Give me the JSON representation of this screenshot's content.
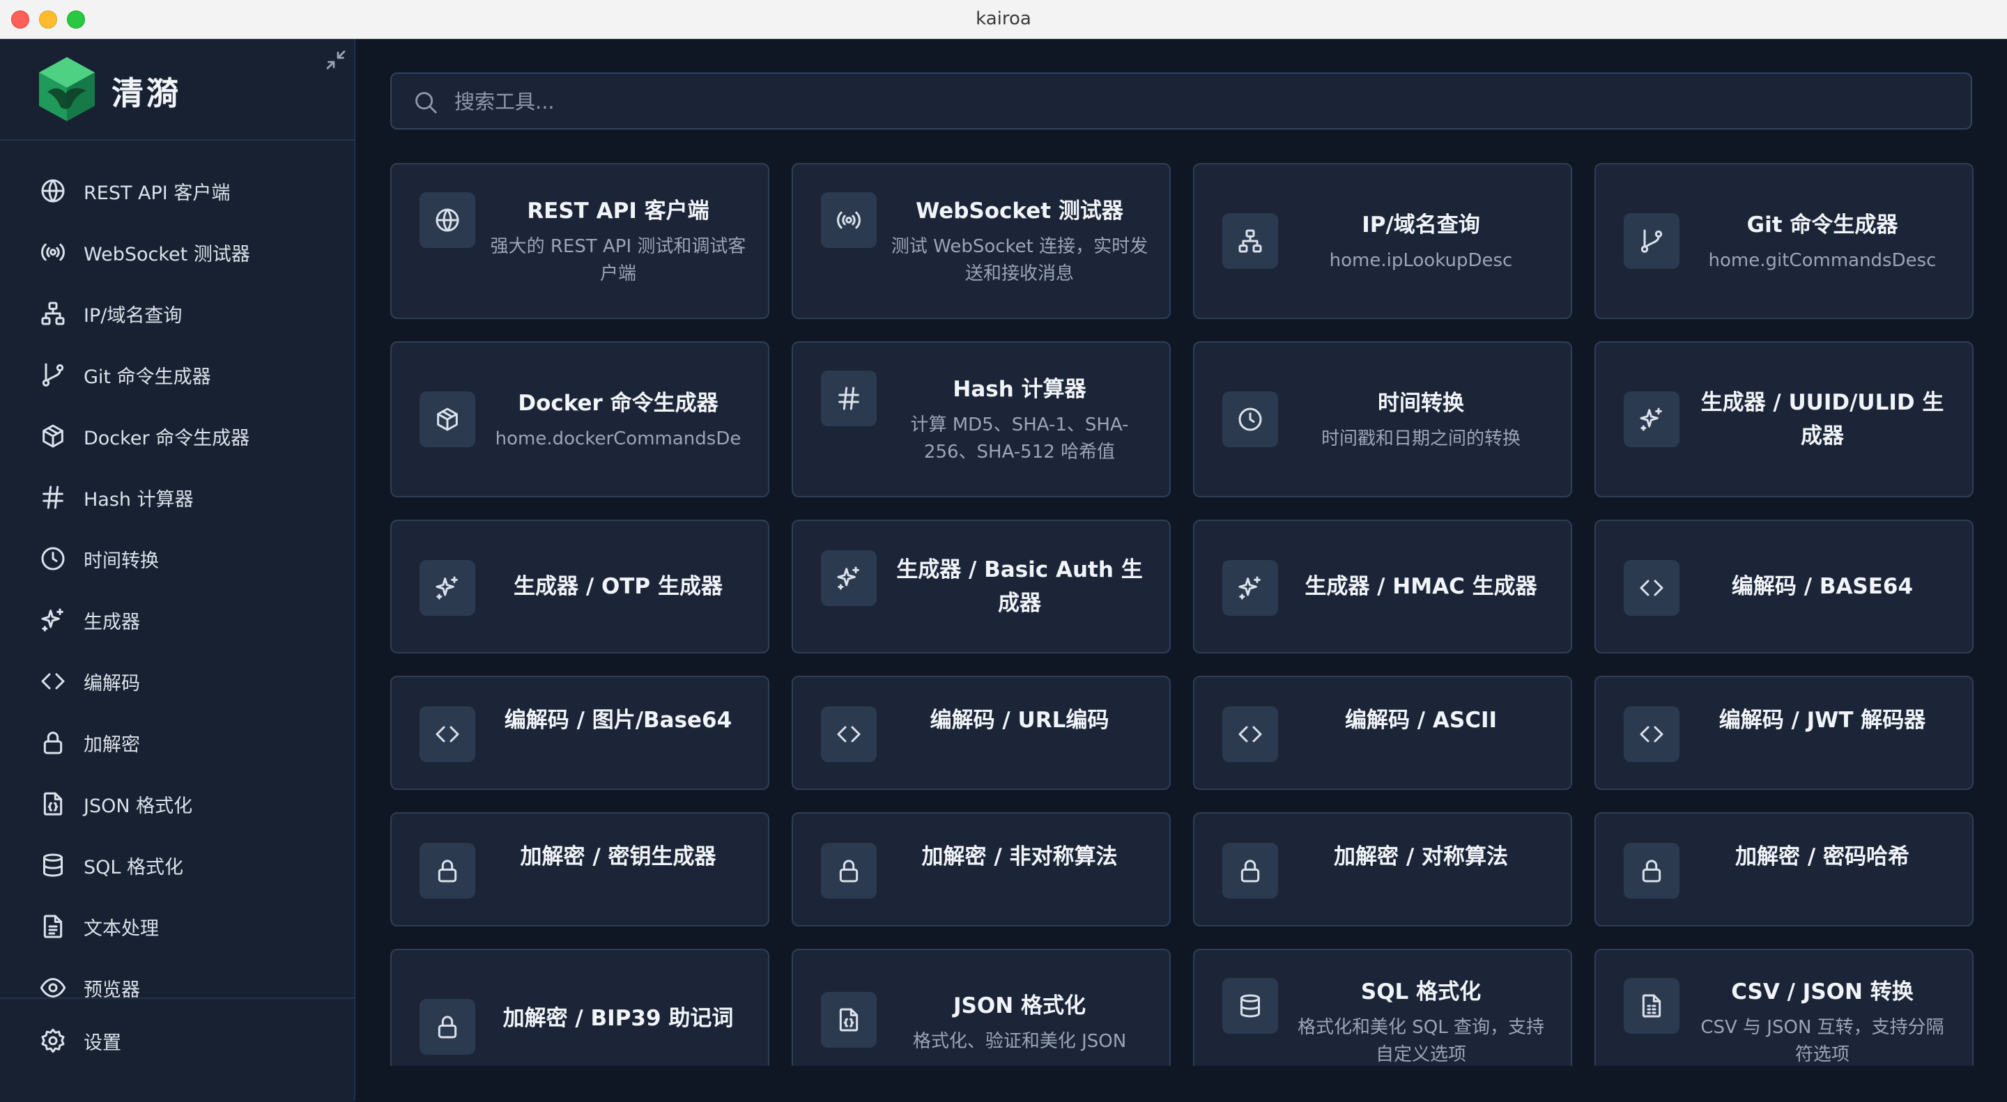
{
  "window": {
    "title": "kairoa"
  },
  "brand": {
    "name": "清漪"
  },
  "search": {
    "placeholder": "搜索工具..."
  },
  "sidebar": {
    "items": [
      {
        "label": "REST API 客户端",
        "icon": "globe-icon"
      },
      {
        "label": "WebSocket 测试器",
        "icon": "radio-icon"
      },
      {
        "label": "IP/域名查询",
        "icon": "network-icon"
      },
      {
        "label": "Git 命令生成器",
        "icon": "git-branch-icon"
      },
      {
        "label": "Docker 命令生成器",
        "icon": "package-icon"
      },
      {
        "label": "Hash 计算器",
        "icon": "hash-icon"
      },
      {
        "label": "时间转换",
        "icon": "clock-icon"
      },
      {
        "label": "生成器",
        "icon": "sparkles-icon"
      },
      {
        "label": "编解码",
        "icon": "code-icon"
      },
      {
        "label": "加解密",
        "icon": "lock-icon"
      },
      {
        "label": "JSON 格式化",
        "icon": "file-json-icon"
      },
      {
        "label": "SQL 格式化",
        "icon": "database-icon"
      },
      {
        "label": "文本处理",
        "icon": "file-text-icon"
      },
      {
        "label": "预览器",
        "icon": "eye-icon"
      }
    ],
    "settings": {
      "label": "设置",
      "icon": "gear-icon"
    }
  },
  "cards": [
    {
      "title": "REST API 客户端",
      "desc": "强大的 REST API 测试和调试客户端",
      "icon": "globe-icon"
    },
    {
      "title": "WebSocket 测试器",
      "desc": "测试 WebSocket 连接，实时发送和接收消息",
      "icon": "radio-icon"
    },
    {
      "title": "IP/域名查询",
      "desc": "home.ipLookupDesc",
      "icon": "network-icon"
    },
    {
      "title": "Git 命令生成器",
      "desc": "home.gitCommandsDesc",
      "icon": "git-branch-icon"
    },
    {
      "title": "Docker 命令生成器",
      "desc": "home.dockerCommandsDe",
      "icon": "package-icon"
    },
    {
      "title": "Hash 计算器",
      "desc": "计算 MD5、SHA-1、SHA-256、SHA-512 哈希值",
      "icon": "hash-icon"
    },
    {
      "title": "时间转换",
      "desc": "时间戳和日期之间的转换",
      "icon": "clock-icon"
    },
    {
      "title": "生成器 / UUID/ULID 生成器",
      "desc": "",
      "icon": "sparkles-icon"
    },
    {
      "title": "生成器 / OTP 生成器",
      "desc": "",
      "icon": "sparkles-icon"
    },
    {
      "title": "生成器 / Basic Auth 生成器",
      "desc": "",
      "icon": "sparkles-icon"
    },
    {
      "title": "生成器 / HMAC 生成器",
      "desc": "",
      "icon": "sparkles-icon"
    },
    {
      "title": "编解码 / BASE64",
      "desc": "",
      "icon": "code-icon"
    },
    {
      "title": "编解码 / 图片/Base64",
      "desc": "",
      "icon": "code-icon"
    },
    {
      "title": "编解码 / URL编码",
      "desc": "",
      "icon": "code-icon"
    },
    {
      "title": "编解码 / ASCII",
      "desc": "",
      "icon": "code-icon"
    },
    {
      "title": "编解码 / JWT 解码器",
      "desc": "",
      "icon": "code-icon"
    },
    {
      "title": "加解密 / 密钥生成器",
      "desc": "",
      "icon": "lock-icon"
    },
    {
      "title": "加解密 / 非对称算法",
      "desc": "",
      "icon": "lock-icon"
    },
    {
      "title": "加解密 / 对称算法",
      "desc": "",
      "icon": "lock-icon"
    },
    {
      "title": "加解密 / 密码哈希",
      "desc": "",
      "icon": "lock-icon"
    },
    {
      "title": "加解密 / BIP39 助记词",
      "desc": "",
      "icon": "lock-icon"
    },
    {
      "title": "JSON 格式化",
      "desc": "格式化、验证和美化 JSON",
      "icon": "file-json-icon"
    },
    {
      "title": "SQL 格式化",
      "desc": "格式化和美化 SQL 查询，支持自定义选项",
      "icon": "database-icon"
    },
    {
      "title": "CSV / JSON 转换",
      "desc": "CSV 与 JSON 互转，支持分隔符选项",
      "icon": "file-csv-icon"
    }
  ],
  "colors": {
    "background": "#0f1725",
    "sidebar": "#172131",
    "card": "#1b2537",
    "accent_green": "#2fb36b"
  }
}
